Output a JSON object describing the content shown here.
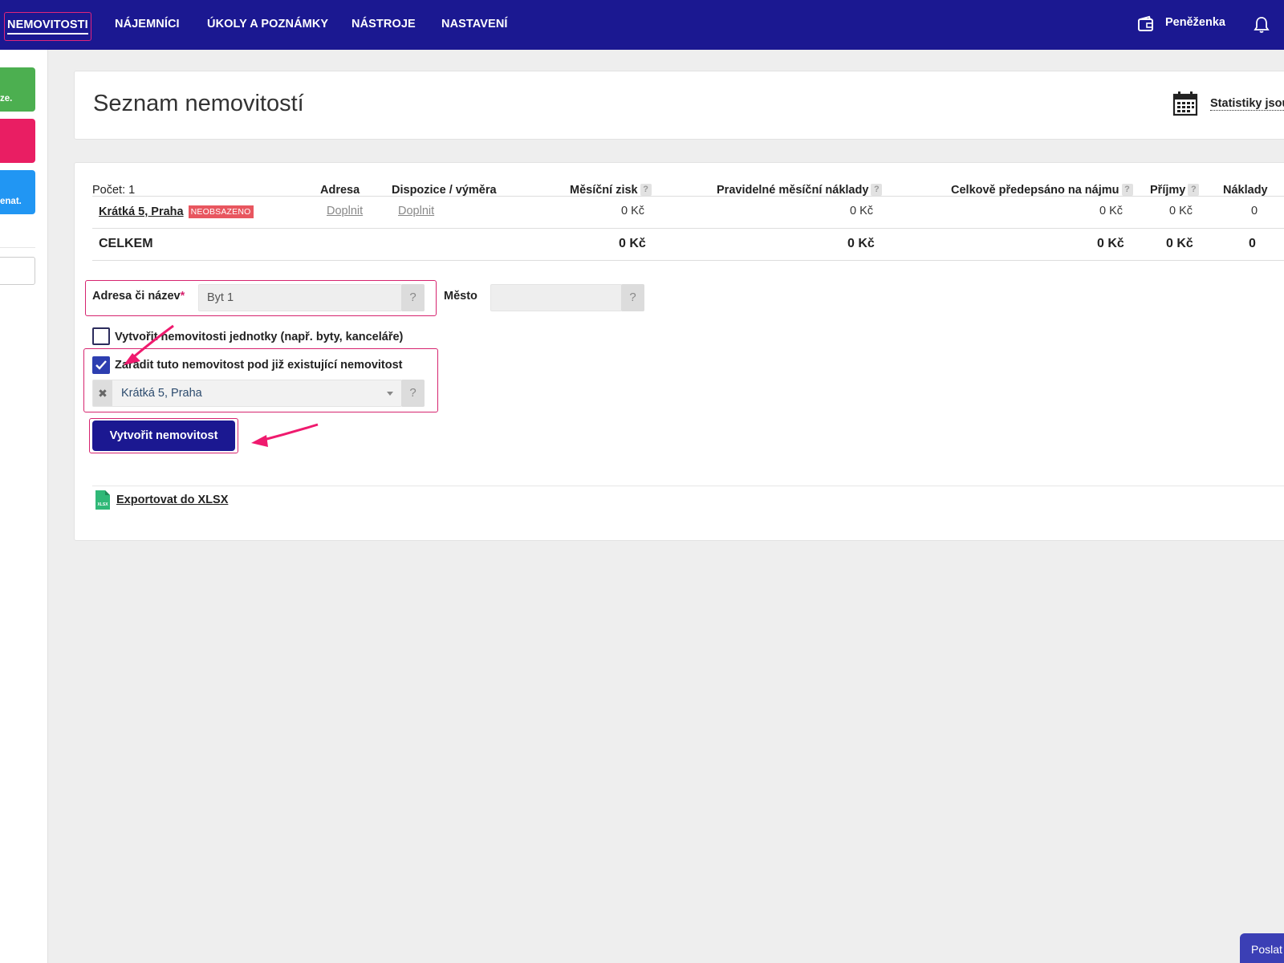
{
  "colors": {
    "nav_bg": "#1b1891",
    "highlight": "#d6246f",
    "primary": "#1b1891",
    "badge": "#e8565f",
    "tile_green": "#4caf50",
    "tile_pink": "#e91e63",
    "tile_blue": "#2196f3"
  },
  "nav": {
    "items": [
      "NEMOVITOSTI",
      "NÁJEMNÍCI",
      "ÚKOLY A POZNÁMKY",
      "NÁSTROJE",
      "NASTAVENÍ"
    ],
    "wallet_label": "Peněženka",
    "wallet_icon": "wallet-icon",
    "bell_icon": "bell-icon"
  },
  "sidebar": {
    "tiles": [
      {
        "text": "ze.",
        "color": "#4caf50"
      },
      {
        "text": "",
        "color": "#e91e63"
      },
      {
        "text": "enat.",
        "color": "#2196f3"
      }
    ]
  },
  "header": {
    "title": "Seznam nemovitostí",
    "stats_label": "Statistiky jsou",
    "stats_icon": "calendar-icon"
  },
  "table": {
    "count_label": "Počet: 1",
    "columns": [
      "Adresa",
      "Dispozice / výměra",
      "Měsíční zisk",
      "Pravidelné měsíční náklady",
      "Celkově předepsáno na nájmu",
      "Příjmy",
      "Náklady"
    ],
    "help_mark": "?",
    "row": {
      "name": "Krátká 5, Praha",
      "badge": "NEOBSAZENO",
      "address": "Doplnit",
      "disposition": "Doplnit",
      "monthly_profit": "0 Kč",
      "monthly_costs": "0 Kč",
      "prescribed": "0 Kč",
      "income": "0 Kč",
      "costs": "0"
    },
    "total": {
      "label": "CELKEM",
      "monthly_profit": "0 Kč",
      "monthly_costs": "0 Kč",
      "prescribed": "0 Kč",
      "income": "0 Kč",
      "costs": "0"
    }
  },
  "form": {
    "name_label": "Adresa či název",
    "required_mark": "*",
    "name_value": "Byt 1",
    "city_label": "Město",
    "city_value": "",
    "help_mark": "?",
    "units_checkbox_label": "Vytvořit nemovitosti jednotky (např. byty, kanceláře)",
    "units_checked": false,
    "parent_checkbox_label": "Zařadit tuto nemovitost pod již existující nemovitost",
    "parent_checked": true,
    "parent_select_value": "Krátká 5, Praha",
    "clear_mark": "✖",
    "submit_label": "Vytvořit nemovitost"
  },
  "export": {
    "label": "Exportovat do XLSX",
    "icon": "xlsx-file-icon",
    "icon_text": "XLSX"
  },
  "feedback": {
    "label": "Poslat"
  }
}
